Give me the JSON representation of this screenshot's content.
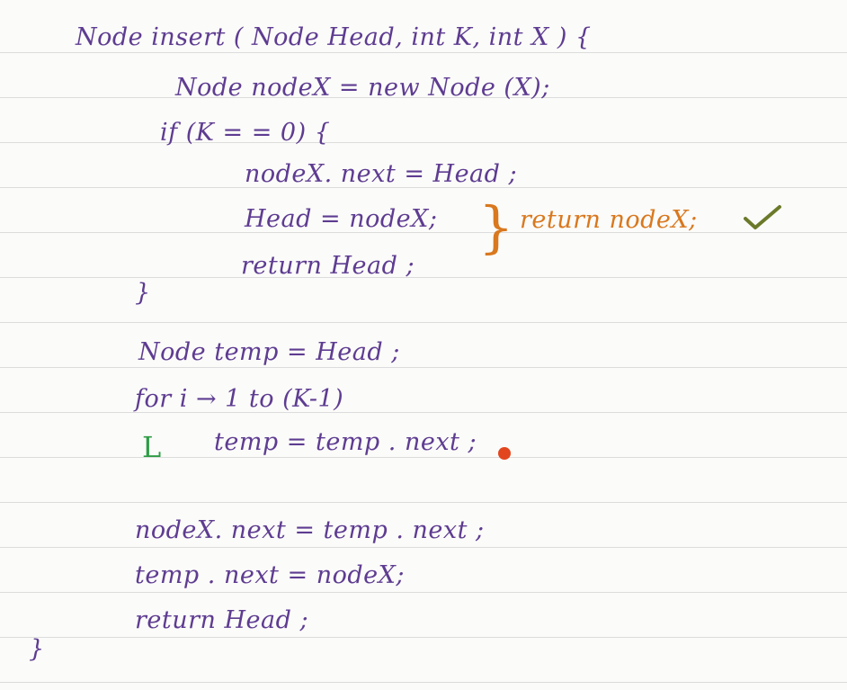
{
  "code_lines": [
    "Node insert ( Node Head, int K, int X ) {",
    "Node nodeX = new Node (X);",
    "if (K = = 0) {",
    "nodeX. next = Head ;",
    "Head = nodeX;",
    "return Head ;",
    "}",
    "Node temp = Head ;",
    "for i → 1 to (K-1)",
    "L",
    "temp = temp . next ;",
    "nodeX. next = temp . next ;",
    "temp . next = nodeX;",
    "return Head ;",
    "}"
  ],
  "annotation": {
    "text": "return nodeX;",
    "color": "#d9781e",
    "check_icon": "check-icon",
    "check_color": "#6b7a2a"
  },
  "colors": {
    "ink": "#5e3c91",
    "annotation": "#d9781e",
    "loop_marker": "#2f9c46",
    "cursor": "#e2461f",
    "rule_line": "#dcdcdc",
    "paper": "#fbfbf9"
  }
}
